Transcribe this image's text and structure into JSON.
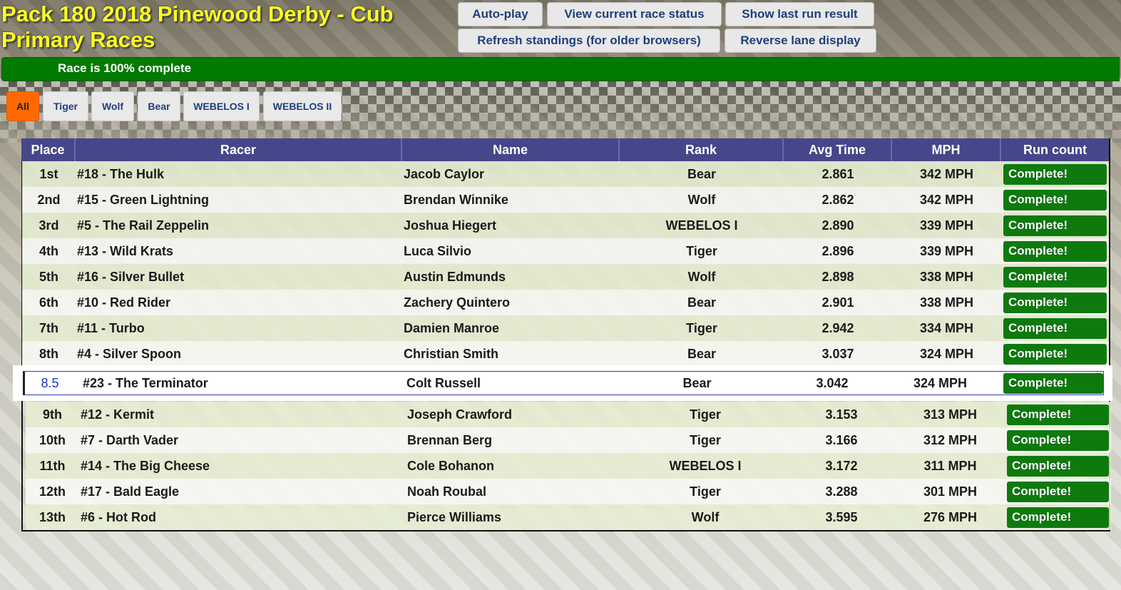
{
  "title": "Pack 180 2018 Pinewood Derby - Cub Primary Races",
  "toolbar": {
    "autoplay": "Auto-play",
    "view_status": "View current race status",
    "show_last": "Show last run result",
    "refresh": "Refresh standings (for older browsers)",
    "reverse": "Reverse lane display"
  },
  "progress": {
    "label": "Race is 100% complete",
    "percent": 100,
    "color": "#007a00"
  },
  "filters": [
    "All",
    "Tiger",
    "Wolf",
    "Bear",
    "WEBELOS I",
    "WEBELOS II"
  ],
  "active_filter": "All",
  "columns": [
    "Place",
    "Racer",
    "Name",
    "Rank",
    "Avg Time",
    "MPH",
    "Run count"
  ],
  "rows": [
    {
      "place": "1st",
      "racer": "#18 - The Hulk",
      "name": "Jacob Caylor",
      "rank": "Bear",
      "avg": "2.861",
      "mph": "342 MPH",
      "runs": "Complete!"
    },
    {
      "place": "2nd",
      "racer": "#15 - Green Lightning",
      "name": "Brendan Winnike",
      "rank": "Wolf",
      "avg": "2.862",
      "mph": "342 MPH",
      "runs": "Complete!"
    },
    {
      "place": "3rd",
      "racer": "#5 - The Rail Zeppelin",
      "name": "Joshua Hiegert",
      "rank": "WEBELOS I",
      "avg": "2.890",
      "mph": "339 MPH",
      "runs": "Complete!"
    },
    {
      "place": "4th",
      "racer": "#13 - Wild Krats",
      "name": "Luca Silvio",
      "rank": "Tiger",
      "avg": "2.896",
      "mph": "339 MPH",
      "runs": "Complete!"
    },
    {
      "place": "5th",
      "racer": "#16 - Silver Bullet",
      "name": "Austin Edmunds",
      "rank": "Wolf",
      "avg": "2.898",
      "mph": "338 MPH",
      "runs": "Complete!"
    },
    {
      "place": "6th",
      "racer": "#10 - Red Rider",
      "name": "Zachery Quintero",
      "rank": "Bear",
      "avg": "2.901",
      "mph": "338 MPH",
      "runs": "Complete!"
    },
    {
      "place": "7th",
      "racer": "#11 - Turbo",
      "name": "Damien Manroe",
      "rank": "Tiger",
      "avg": "2.942",
      "mph": "334 MPH",
      "runs": "Complete!"
    },
    {
      "place": "8th",
      "racer": "#4 - Silver Spoon",
      "name": "Christian Smith",
      "rank": "Bear",
      "avg": "3.037",
      "mph": "324 MPH",
      "runs": "Complete!"
    }
  ],
  "highlight_row": {
    "place": "8.5",
    "racer": "#23 - The Terminator",
    "name": "Colt Russell",
    "rank": "Bear",
    "avg": "3.042",
    "mph": "324 MPH",
    "runs": "Complete!"
  },
  "rows_after": [
    {
      "place": "9th",
      "racer": "#12 - Kermit",
      "name": "Joseph Crawford",
      "rank": "Tiger",
      "avg": "3.153",
      "mph": "313 MPH",
      "runs": "Complete!"
    },
    {
      "place": "10th",
      "racer": "#7 - Darth Vader",
      "name": "Brennan Berg",
      "rank": "Tiger",
      "avg": "3.166",
      "mph": "312 MPH",
      "runs": "Complete!"
    },
    {
      "place": "11th",
      "racer": "#14 - The Big Cheese",
      "name": "Cole Bohanon",
      "rank": "WEBELOS I",
      "avg": "3.172",
      "mph": "311 MPH",
      "runs": "Complete!"
    },
    {
      "place": "12th",
      "racer": "#17 - Bald Eagle",
      "name": "Noah Roubal",
      "rank": "Tiger",
      "avg": "3.288",
      "mph": "301 MPH",
      "runs": "Complete!"
    },
    {
      "place": "13th",
      "racer": "#6 - Hot Rod",
      "name": "Pierce Williams",
      "rank": "Wolf",
      "avg": "3.595",
      "mph": "276 MPH",
      "runs": "Complete!"
    }
  ],
  "colors": {
    "title": "#ffff22",
    "header_bg": "#46468a",
    "complete_bg": "#0e7a0e",
    "filter_active": "#ff6a00",
    "link_text": "#1f3e7c"
  }
}
